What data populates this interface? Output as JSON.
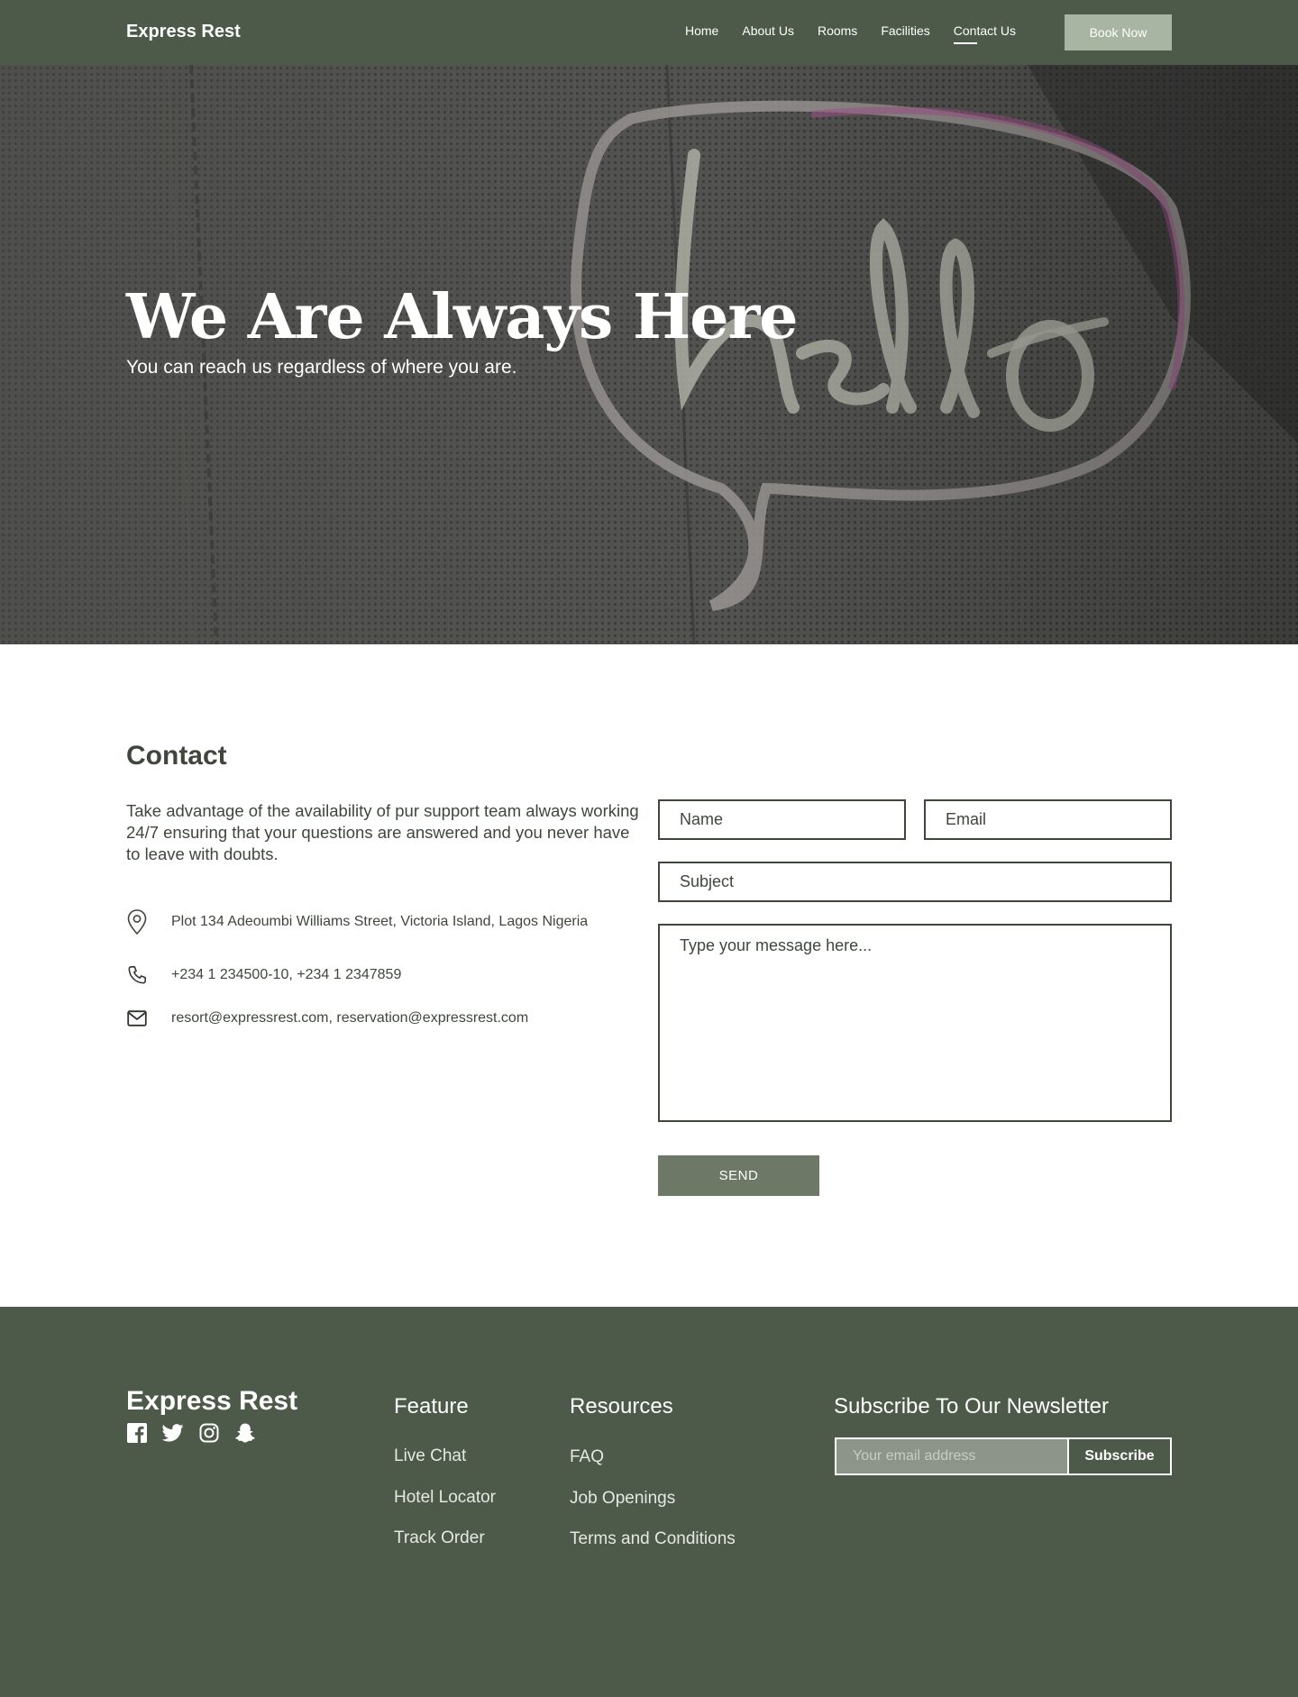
{
  "nav": {
    "brand": "Express Rest",
    "links": [
      "Home",
      "About Us",
      "Rooms",
      "Facilities",
      "Contact Us"
    ],
    "active_link": "Contact Us",
    "book_label": "Book Now"
  },
  "hero": {
    "title": "We Are Always Here",
    "subtitle": "You can reach us regardless of where you are."
  },
  "contact": {
    "heading": "Contact",
    "intro": "Take advantage of the availability of pur support team always working 24/7 ensuring that your questions are answered and you never have to leave with doubts.",
    "address": "Plot 134 Adeoumbi Williams Street, Victoria Island, Lagos Nigeria",
    "phone": "+234 1 234500-10, +234 1 2347859",
    "email": "resort@expressrest.com, reservation@expressrest.com",
    "icons": [
      "map-pin-icon",
      "phone-icon",
      "mail-icon"
    ]
  },
  "form": {
    "name_placeholder": "Name",
    "email_placeholder": "Email",
    "subject_placeholder": "Subject",
    "message_placeholder": "Type your message here...",
    "send_label": "SEND"
  },
  "footer": {
    "brand": "Express Rest",
    "social_icons": [
      "facebook-icon",
      "twitter-icon",
      "instagram-icon",
      "snapchat-icon"
    ],
    "feature_title": "Feature",
    "feature_links": [
      "Live Chat",
      "Hotel Locator",
      "Track Order"
    ],
    "resources_title": "Resources",
    "resources_links": [
      "FAQ",
      "Job Openings",
      "Terms and Conditions"
    ],
    "newsletter_title": "Subscribe To Our Newsletter",
    "newsletter_placeholder": "Your email address",
    "subscribe_label": "Subscribe"
  },
  "colors": {
    "primary": "#4d5949",
    "accent": "#a8b5a2",
    "button": "#6d7866",
    "text": "#3f463c"
  }
}
